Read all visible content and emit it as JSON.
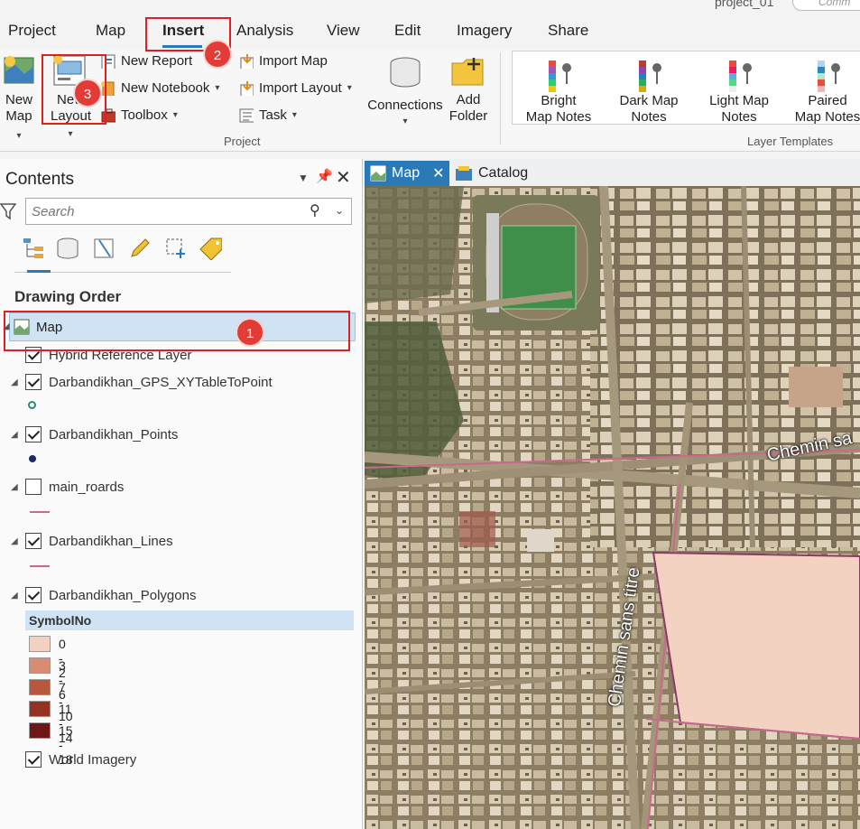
{
  "window": {
    "project_name": "project_01",
    "command_search_placeholder": "Comm"
  },
  "ribbon": {
    "tabs": [
      "Project",
      "Map",
      "Insert",
      "Analysis",
      "View",
      "Edit",
      "Imagery",
      "Share"
    ],
    "active_tab": "Insert",
    "project_group": {
      "label": "Project",
      "new_map": [
        "New",
        "Map"
      ],
      "new_layout": [
        "New",
        "Layout"
      ],
      "new_report": "New Report",
      "new_notebook": "New Notebook",
      "toolbox": "Toolbox",
      "import_map": "Import Map",
      "import_layout": "Import Layout",
      "task": "Task",
      "connections": "Connections",
      "add_folder": [
        "Add",
        "Folder"
      ]
    },
    "layer_templates": {
      "label": "Layer Templates",
      "items": [
        [
          "Bright",
          "Map Notes"
        ],
        [
          "Dark Map",
          "Notes"
        ],
        [
          "Light Map",
          "Notes"
        ],
        [
          "Paired",
          "Map Notes"
        ]
      ]
    }
  },
  "callouts": [
    "1",
    "2",
    "3"
  ],
  "contents": {
    "title": "Contents",
    "search_placeholder": "Search",
    "section": "Drawing Order",
    "map_item": "Map",
    "layers": [
      {
        "name": "Hybrid Reference Layer",
        "checked": true
      },
      {
        "name": "Darbandikhan_GPS_XYTableToPoint",
        "checked": true
      },
      {
        "name": "Darbandikhan_Points",
        "checked": true
      },
      {
        "name": "main_roards",
        "checked": false
      },
      {
        "name": "Darbandikhan_Lines",
        "checked": true
      },
      {
        "name": "Darbandikhan_Polygons",
        "checked": true
      },
      {
        "name": "World Imagery",
        "checked": true
      }
    ],
    "legend": {
      "field": "SymbolNo",
      "classes": [
        {
          "label": "0 - 2",
          "color": "#f3d2c1"
        },
        {
          "label": "3 - 6",
          "color": "#d98b72"
        },
        {
          "label": "7 - 10",
          "color": "#b9573b"
        },
        {
          "label": "11 - 14",
          "color": "#963222"
        },
        {
          "label": "15 - 18",
          "color": "#6e1716"
        }
      ]
    }
  },
  "view_tabs": {
    "map": "Map",
    "catalog": "Catalog"
  },
  "map": {
    "road_label_1": "Chemin sans titre",
    "road_label_2": "Chemin sa",
    "polygon_fill": "#f3d2c1"
  },
  "colors": {
    "accent": "#2a7ab8",
    "callout": "#e02020"
  }
}
